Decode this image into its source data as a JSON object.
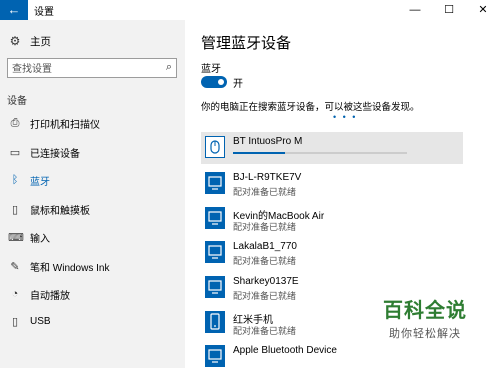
{
  "window": {
    "title": "设置",
    "back_glyph": "←",
    "minimize_glyph": "—",
    "maximize_glyph": "☐",
    "close_glyph": "✕",
    "accent_color": "#0063b1"
  },
  "sidebar": {
    "home": {
      "label": "主页",
      "icon": "gear-icon"
    },
    "search": {
      "placeholder": "查找设置",
      "icon": "search-icon"
    },
    "section_label": "设备",
    "items": [
      {
        "label": "打印机和扫描仪",
        "icon": "printer-icon",
        "active": false
      },
      {
        "label": "已连接设备",
        "icon": "connected-devices-icon",
        "active": false
      },
      {
        "label": "蓝牙",
        "icon": "bluetooth-icon",
        "active": true
      },
      {
        "label": "鼠标和触摸板",
        "icon": "mouse-icon",
        "active": false
      },
      {
        "label": "输入",
        "icon": "keyboard-icon",
        "active": false
      },
      {
        "label": "笔和 Windows Ink",
        "icon": "pen-icon",
        "active": false
      },
      {
        "label": "自动播放",
        "icon": "autoplay-icon",
        "active": false
      },
      {
        "label": "USB",
        "icon": "usb-icon",
        "active": false
      }
    ]
  },
  "main": {
    "title": "管理蓝牙设备",
    "bluetooth_label": "蓝牙",
    "toggle_state": "开",
    "toggle_on": true,
    "scan_text": "你的电脑正在搜索蓝牙设备，可以被这些设备发现。",
    "scan_dots": "• • •",
    "devices": [
      {
        "name": "BT IntuosPro M",
        "status": "",
        "icon": "mouse-device-icon",
        "selected": true,
        "progress": 0.3
      },
      {
        "name": "BJ-L-R9TKE7V",
        "status": "配对准备已就绪",
        "icon": "computer-device-icon",
        "selected": false
      },
      {
        "name": "Kevin的MacBook Air",
        "status": "配对准备已就绪",
        "icon": "computer-device-icon",
        "selected": false
      },
      {
        "name": "LakalaB1_770",
        "status": "配对准备已就绪",
        "icon": "computer-device-icon",
        "selected": false
      },
      {
        "name": "Sharkey0137E",
        "status": "配对准备已就绪",
        "icon": "computer-device-icon",
        "selected": false
      },
      {
        "name": "红米手机",
        "status": "配对准备已就绪",
        "icon": "phone-device-icon",
        "selected": false
      },
      {
        "name": "Apple Bluetooth Device",
        "status": "",
        "icon": "computer-device-icon",
        "selected": false
      }
    ]
  },
  "watermark": {
    "main": "百科全说",
    "sub": "助你轻松解决"
  }
}
